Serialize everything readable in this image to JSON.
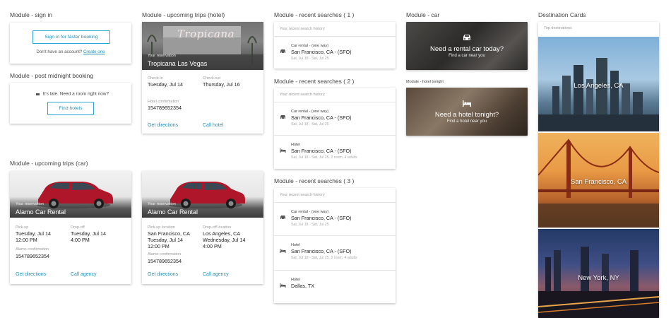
{
  "signin": {
    "title": "Module - sign in",
    "button": "Sign in for faster booking",
    "no_account": "Don't have an account?",
    "create_link": "Create one"
  },
  "midnight": {
    "title": "Module - post midnight booking",
    "message": "It's late. Need a room right now?",
    "button": "Find hotels"
  },
  "hotel_trip": {
    "title": "Module - upcoming trips (hotel)",
    "subtitle": "Your reservation",
    "name": "Tropicana Las Vegas",
    "hero_sign": "Tropicana",
    "checkin_label": "Check-in",
    "checkin_value": "Tuesday, Jul 14",
    "checkout_label": "Check-out",
    "checkout_value": "Thursday, Jul 16",
    "conf_label": "Hotel confirmation",
    "conf_value": "154789652354",
    "directions": "Get directions",
    "call": "Call hotel"
  },
  "car_trips_title": "Module - upcoming trips (car)",
  "car_trip_1": {
    "subtitle": "Your reservation",
    "name": "Alamo Car Rental",
    "pickup_label": "Pick-up",
    "pickup_date": "Tuesday, Jul 14",
    "pickup_time": "12:00 PM",
    "dropoff_label": "Drop-off",
    "dropoff_date": "Tuesday, Jul 14",
    "dropoff_time": "4:00 PM",
    "conf_label": "Alamo confirmation",
    "conf_value": "154789652354",
    "directions": "Get directions",
    "call": "Call agency"
  },
  "car_trip_2": {
    "subtitle": "Your reservation",
    "name": "Alamo Car Rental",
    "pickup_label": "Pick-up location",
    "pickup_loc": "San Francisco, CA",
    "pickup_date": "Tuesday, Jul 14",
    "pickup_time": "12:00 PM",
    "dropoff_label": "Drop-off location",
    "dropoff_loc": "Los Angeles, CA",
    "dropoff_date": "Wednesday, Jul 14",
    "dropoff_time": "4:00 PM",
    "conf_label": "Alamo confirmation",
    "conf_value": "154789652354",
    "directions": "Get directions",
    "call": "Call agency"
  },
  "recent1": {
    "title": "Module - recent searches ( 1 )",
    "header": "Your recent search history",
    "items": [
      {
        "type": "Car rental - (one way)",
        "loc": "San Francisco, CA - (SFO)",
        "dates": "Sat, Jul 18 - Sat, Jul 25"
      }
    ]
  },
  "recent2": {
    "title": "Module - recent searches ( 2 )",
    "header": "Your recent search history",
    "items": [
      {
        "type": "Car rental - (one way)",
        "loc": "San Francisco, CA - (SFO)",
        "dates": "Sat, Jul 18 - Sat, Jul 25"
      },
      {
        "type": "Hotel",
        "loc": "San Francisco, CA - (SFO)",
        "dates": "Sat, Jul 18 - Sat, Jul 25, 2 room, 4 adults"
      }
    ]
  },
  "recent3": {
    "title": "Module - recent searches ( 3 )",
    "header": "Your recent search history",
    "items": [
      {
        "type": "Car rental - (one way)",
        "loc": "San Francisco, CA - (SFO)",
        "dates": "Sat, Jul 18 - Sat, Jul 25"
      },
      {
        "type": "Hotel",
        "loc": "San Francisco, CA - (SFO)",
        "dates": "Sat, Jul 18 - Sat, Jul 25, 2 room, 4 adults"
      },
      {
        "type": "Hotel",
        "loc": "Dallas, TX",
        "dates": ""
      }
    ]
  },
  "car_module": {
    "title": "Module - car",
    "headline": "Need a rental car today?",
    "sub": "Find a car near you"
  },
  "hotel_tonight": {
    "title": "Module - hotel tonight",
    "headline": "Need a hotel tonight?",
    "sub": "Find a hotel near you"
  },
  "destinations": {
    "title": "Destination Cards",
    "header": "Top destinations",
    "items": [
      {
        "name": "Los Angeles, CA"
      },
      {
        "name": "San Francisco, CA"
      },
      {
        "name": "New York, NY"
      }
    ]
  },
  "colors": {
    "accent": "#1f8fba",
    "text": "#222222",
    "muted": "#9a9a9a"
  }
}
